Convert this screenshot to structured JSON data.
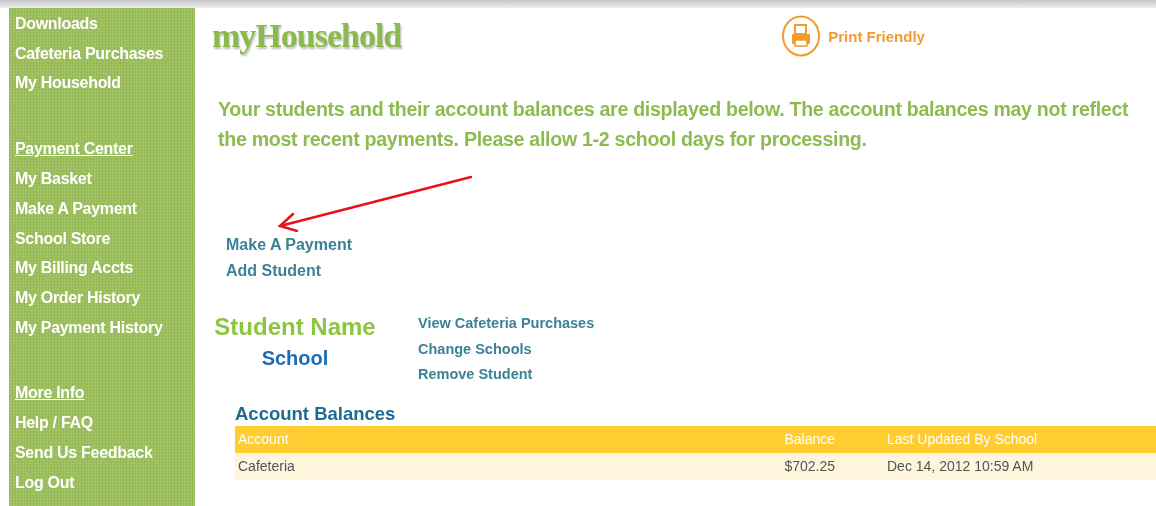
{
  "sidebar": {
    "groups": [
      {
        "items": [
          "Downloads",
          "Cafeteria Purchases",
          "My Household"
        ]
      },
      {
        "heading": "Payment Center",
        "items": [
          "My Basket",
          "Make A Payment",
          "School Store",
          "My Billing Accts",
          "My Order History",
          "My Payment History"
        ]
      },
      {
        "heading": "More Info",
        "items": [
          "Help / FAQ",
          "Send Us Feedback",
          "Log Out"
        ]
      }
    ]
  },
  "page_title": "myHousehold",
  "print_link": "Print Friendly",
  "notice": "Your students and their account balances are displayed below. The account balances may not reflect the most recent payments. Please allow 1-2 school days for processing.",
  "actions": [
    "Make A Payment",
    "Add Student"
  ],
  "student": {
    "name": "Student Name",
    "school": "School",
    "actions": [
      "View Cafeteria Purchases",
      "Change Schools",
      "Remove Student"
    ]
  },
  "account_balances": {
    "title": "Account Balances",
    "columns": [
      "Account",
      "Balance",
      "Last Updated By School"
    ],
    "rows": [
      [
        "Cafeteria",
        "$702.25",
        "Dec 14, 2012 10:59 AM"
      ]
    ]
  }
}
